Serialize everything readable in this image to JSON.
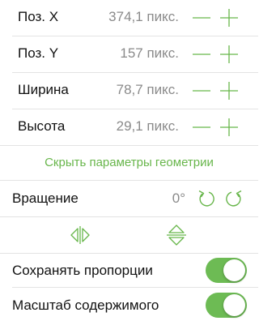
{
  "colors": {
    "accent": "#68b64b",
    "toggle_on": "#6dbb54",
    "secondary_text": "#8a8a8a"
  },
  "geometry": {
    "rows": [
      {
        "label": "Поз. X",
        "value": "374,1 пикс."
      },
      {
        "label": "Поз. Y",
        "value": "157 пикс."
      },
      {
        "label": "Ширина",
        "value": "78,7 пикс."
      },
      {
        "label": "Высота",
        "value": "29,1 пикс."
      }
    ],
    "hide_link": "Скрыть параметры геометрии"
  },
  "rotation": {
    "label": "Вращение",
    "value": "0°",
    "icons": [
      "rotate-counterclockwise-icon",
      "rotate-clockwise-icon"
    ]
  },
  "flip": {
    "icons": [
      "flip-horizontal-icon",
      "flip-vertical-icon"
    ]
  },
  "toggles": [
    {
      "label": "Сохранять пропорции",
      "on": true
    },
    {
      "label": "Масштаб содержимого",
      "on": true
    }
  ]
}
